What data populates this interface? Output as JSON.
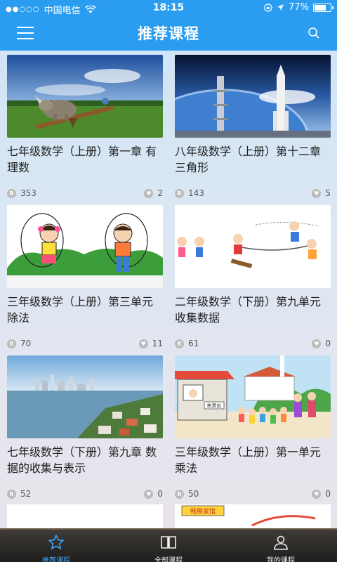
{
  "status_bar": {
    "carrier": "中国电信",
    "time": "18:15",
    "battery_text": "77%",
    "battery_level": 0.77
  },
  "header": {
    "title": "推荐课程",
    "menu_icon": "hamburger-menu-icon",
    "search_icon": "search-icon"
  },
  "courses": [
    {
      "title": "七年级数学（上册）第一章 有理数",
      "views": "353",
      "likes": "2"
    },
    {
      "title": "八年级数学（上册）第十二章 三角形",
      "views": "143",
      "likes": "5"
    },
    {
      "title": "三年级数学（上册）第三单元 除法",
      "views": "70",
      "likes": "11"
    },
    {
      "title": "二年级数学（下册）第九单元　收集数据",
      "views": "61",
      "likes": "0"
    },
    {
      "title": "七年级数学（下册）第九章 数据的收集与表示",
      "views": "52",
      "likes": "0"
    },
    {
      "title": "三年级数学（上册）第一单元　乘法",
      "views": "50",
      "likes": "0"
    }
  ],
  "partial_sign_text": "畅展家馆",
  "scene_sign_text": "售票处",
  "tabbar": {
    "items": [
      {
        "label": "推荐课程",
        "icon": "star-icon",
        "active": true
      },
      {
        "label": "全部课程",
        "icon": "book-icon",
        "active": false
      },
      {
        "label": "我的课程",
        "icon": "user-icon",
        "active": false
      }
    ]
  },
  "colors": {
    "accent": "#2b9df0",
    "tab_active": "#3aa6ff"
  }
}
